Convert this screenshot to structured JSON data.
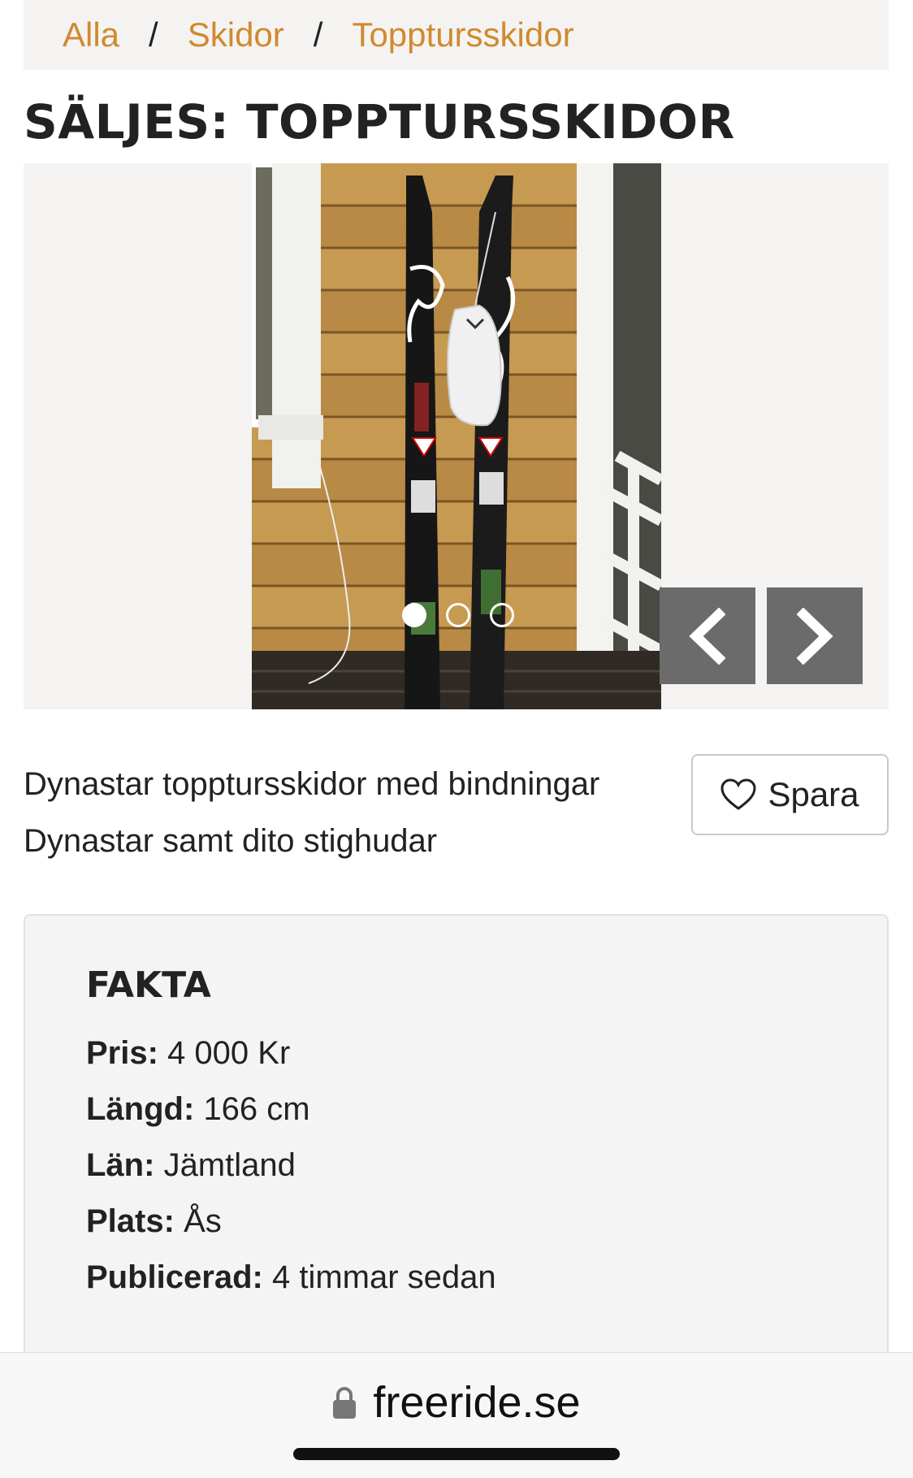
{
  "breadcrumb": {
    "items": [
      "Alla",
      "Skidor",
      "Topptursskidor"
    ],
    "separator": "/"
  },
  "page_title": "SÄLJES: TOPPTURSSKIDOR",
  "gallery": {
    "image_count": 3,
    "active_index": 0,
    "prev_icon": "chevron-left-icon",
    "next_icon": "chevron-right-icon"
  },
  "description": {
    "line1": "Dynastar topptursskidor med bindningar",
    "line2": "Dynastar samt dito stighudar"
  },
  "save_button": {
    "label": "Spara",
    "icon": "heart-icon"
  },
  "fakta": {
    "title": "FAKTA",
    "rows": [
      {
        "label": "Pris:",
        "value": "4 000 Kr"
      },
      {
        "label": "Längd:",
        "value": "166 cm"
      },
      {
        "label": "Län:",
        "value": "Jämtland"
      },
      {
        "label": "Plats:",
        "value": "Ås"
      },
      {
        "label": "Publicerad:",
        "value": "4 timmar sedan"
      }
    ]
  },
  "browser": {
    "url": "freeride.se",
    "lock_icon": "lock-icon"
  },
  "colors": {
    "link": "#d1892f",
    "panel_bg": "#f4f3f2",
    "nav_button": "#6b6b6b"
  }
}
